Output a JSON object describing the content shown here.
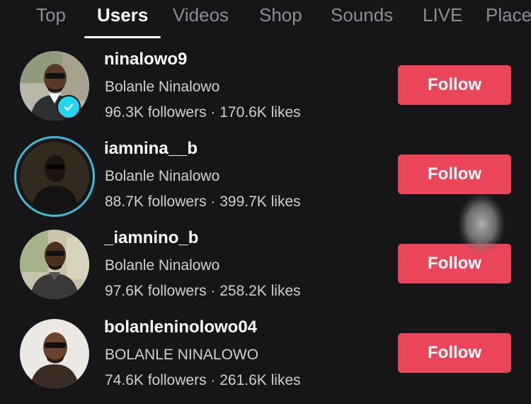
{
  "tabs": [
    {
      "label": "Top",
      "active": false
    },
    {
      "label": "Users",
      "active": true
    },
    {
      "label": "Videos",
      "active": false
    },
    {
      "label": "Shop",
      "active": false
    },
    {
      "label": "Sounds",
      "active": false
    },
    {
      "label": "LIVE",
      "active": false
    },
    {
      "label": "Place",
      "active": false
    }
  ],
  "users": [
    {
      "username": "ninalowo9",
      "display_name": "Bolanle Ninalowo",
      "stats": "96.3K followers · 170.6K likes",
      "follow_label": "Follow",
      "verified": true,
      "has_story": false
    },
    {
      "username": "iamnina__b",
      "display_name": "Bolanle Ninalowo",
      "stats": "88.7K followers · 399.7K likes",
      "follow_label": "Follow",
      "verified": false,
      "has_story": true
    },
    {
      "username": "_iamnino_b",
      "display_name": "Bolanle Ninalowo",
      "stats": "97.6K followers · 258.2K likes",
      "follow_label": "Follow",
      "verified": false,
      "has_story": false
    },
    {
      "username": "bolanleninolowo04",
      "display_name": "BOLANLE NINALOWO",
      "stats": "74.6K followers · 261.6K likes",
      "follow_label": "Follow",
      "verified": false,
      "has_story": false
    }
  ],
  "colors": {
    "background": "#161518",
    "follow_button": "#ea4558",
    "story_ring": "#3bbcd6",
    "verified_badge": "#20d5ec",
    "tab_inactive": "#8d8c92"
  },
  "icons": {
    "verified": "verified-check-icon"
  }
}
